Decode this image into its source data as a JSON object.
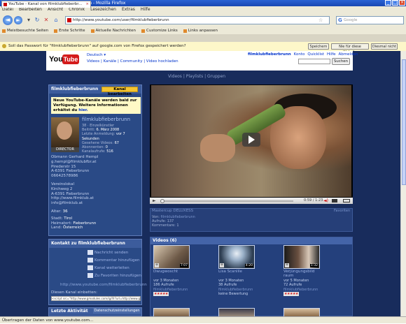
{
  "window": {
    "title": "YouTube - Kanal von filmklubfieberbrunn - Mozilla Firefox"
  },
  "menu": [
    "Datei",
    "Bearbeiten",
    "Ansicht",
    "Chronik",
    "Lesezeichen",
    "Extras",
    "Hilfe"
  ],
  "address": {
    "url": "http://www.youtube.com/user/filmklubfieberbrunn",
    "search_placeholder": "Google"
  },
  "bookmarks": [
    "Meistbesuchte Seiten",
    "Erste Schritte",
    "Aktuelle Nachrichten",
    "Customize Links",
    "Links anpassen"
  ],
  "tab": {
    "label": "YouTube - Kanal von filmklubfieberbr..."
  },
  "password_bar": {
    "message": "Soll das Passwort für \"filmklubfieberbrunn\" auf google.com von Firefox gespeichert werden?",
    "save": "Speichern",
    "never": "Nie für diese Website",
    "not_now": "Diesmal nicht"
  },
  "yt": {
    "logo_you": "You",
    "logo_tube": "Tube",
    "language": "Deutsch",
    "nav": "Videos | Kanäle | Community | Video hochladen",
    "user": "filmklubfieberbrunn",
    "user_links": [
      "Konto",
      "Quicklist",
      "Hilfe",
      "Abmelden"
    ],
    "search_button": "Suchen",
    "channel_tabs": "Videos | Playlists | Gruppen"
  },
  "profile": {
    "header": "filmklubfieberbrunn",
    "edit_button": "Kanal bearbeiten",
    "notice": "Neue YouTube-Kanäle werden bald zur Verfügung. Weitere Informationen erhältst du",
    "notice_link": "hier.",
    "director_badge": "DIRECTOR",
    "name": "filmklubfieberbrunn",
    "stats": [
      {
        "k": "38 · Einzelkünstler",
        "v": ""
      },
      {
        "k": "Beitritt: ",
        "v": "6. März 2008"
      },
      {
        "k": "Letzte Anmeldung: ",
        "v": "vor 7 Sekunden"
      },
      {
        "k": "Gesehene Videos: ",
        "v": "67"
      },
      {
        "k": "Abonnenten: ",
        "v": "0"
      },
      {
        "k": "Kanalaufrufe: ",
        "v": "516"
      }
    ],
    "contact_lines": [
      "Obmann Gerhard Hempl",
      "g.hempl@filmklubfbr.at",
      "Pirederstr 15",
      "A-6391 Fieberbrunn",
      "06642578986",
      "",
      "Vereinslokal",
      "Kirchweg 2",
      "A-6391 Fieberbrunn",
      "http://www.filmklub.at",
      "info@filmklub.at"
    ],
    "details": [
      {
        "k": "Alter: ",
        "v": "36"
      },
      {
        "k": "Stadt: ",
        "v": "Tirol"
      },
      {
        "k": "Heimatort: ",
        "v": "Fieberbrunn"
      },
      {
        "k": "Land: ",
        "v": "Österreich"
      }
    ]
  },
  "contact": {
    "header": "Kontakt zu filmklubfieberbrunn",
    "options": [
      "Nachricht senden",
      "Kommentar hinzufügen",
      "Kanal weiterleiten",
      "Zu Favoriten hinzufügen"
    ],
    "channel_url": "http://www.youtube.com/filmklubfieberbrunn",
    "embed_label": "Diesen Kanal einbetten:",
    "embed_code": "<script src=\"http://www.gmodules.com/ig/ifr?url=http://www.google.com/ig/modules/y"
  },
  "activity": {
    "header": "Letzte Aktivität",
    "settings": "Datenschutzeinstellungen"
  },
  "player": {
    "time": "0:59 / 1:23"
  },
  "video_info": {
    "title": "Mastercup DELUXESS",
    "favorite": "Favoriten",
    "from_label": "Von: ",
    "from": "filmklubfieberbrunn",
    "views_label": "Aufrufe: ",
    "views": "137",
    "comments_label": "Kommentare: ",
    "comments": "1"
  },
  "videos": {
    "header": "Videos (6)",
    "items": [
      {
        "title": "Dwugwoscht",
        "duration": "7:07",
        "age": "vor 3 Monaten",
        "views": "186 Aufrufe",
        "user": "filmklubfieberbrunn",
        "rating_label": "★★★★★",
        "has_rating": true
      },
      {
        "title": "Lisa Scanlile",
        "duration": "4:20",
        "age": "vor 3 Monaten",
        "views": "38 Aufrufe",
        "user": "filmklubfieberbrunn",
        "rating_label": "keine Bewertung",
        "has_rating": false
      },
      {
        "title": "Verjüngungsbild raum",
        "duration": "1:32",
        "age": "vor 5 Monaten",
        "views": "72 Aufrufe",
        "user": "filmklubfieberbrunn",
        "rating_label": "★★★★★",
        "has_rating": true
      }
    ]
  },
  "statusbar": {
    "text": "Übertragen der Daten von www.youtube.com..."
  },
  "colors": {
    "page_bg": "#182c5c",
    "panel": "#2a4a86",
    "accent": "#f4c430",
    "link": "#0033cc",
    "yt_red": "#d41b1b"
  }
}
